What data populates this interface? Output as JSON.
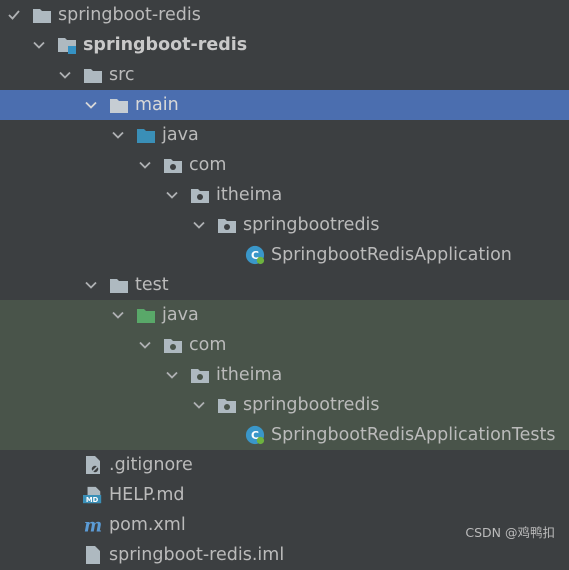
{
  "tree": {
    "root_label": "springboot-redis",
    "module_label": "springboot-redis",
    "src_label": "src",
    "main_label": "main",
    "main_java_label": "java",
    "main_com_label": "com",
    "main_itheima_label": "itheima",
    "main_pkg_label": "springbootredis",
    "main_class_label": "SpringbootRedisApplication",
    "test_label": "test",
    "test_java_label": "java",
    "test_com_label": "com",
    "test_itheima_label": "itheima",
    "test_pkg_label": "springbootredis",
    "test_class_label": "SpringbootRedisApplicationTests",
    "gitignore_label": ".gitignore",
    "help_label": "HELP.md",
    "pom_label": "pom.xml",
    "iml_label": "springboot-redis.iml"
  },
  "icons": {
    "folder": "folder-icon",
    "source_root": "source-folder-icon",
    "test_root": "test-source-folder-icon",
    "package": "package-icon",
    "spring_class": "spring-boot-class-icon"
  },
  "colors": {
    "background": "#3c3f41",
    "selection": "#4b6eaf",
    "test_highlight": "#49544a",
    "text": "#bbbbbb"
  },
  "watermark": "CSDN @鸡鸭扣"
}
